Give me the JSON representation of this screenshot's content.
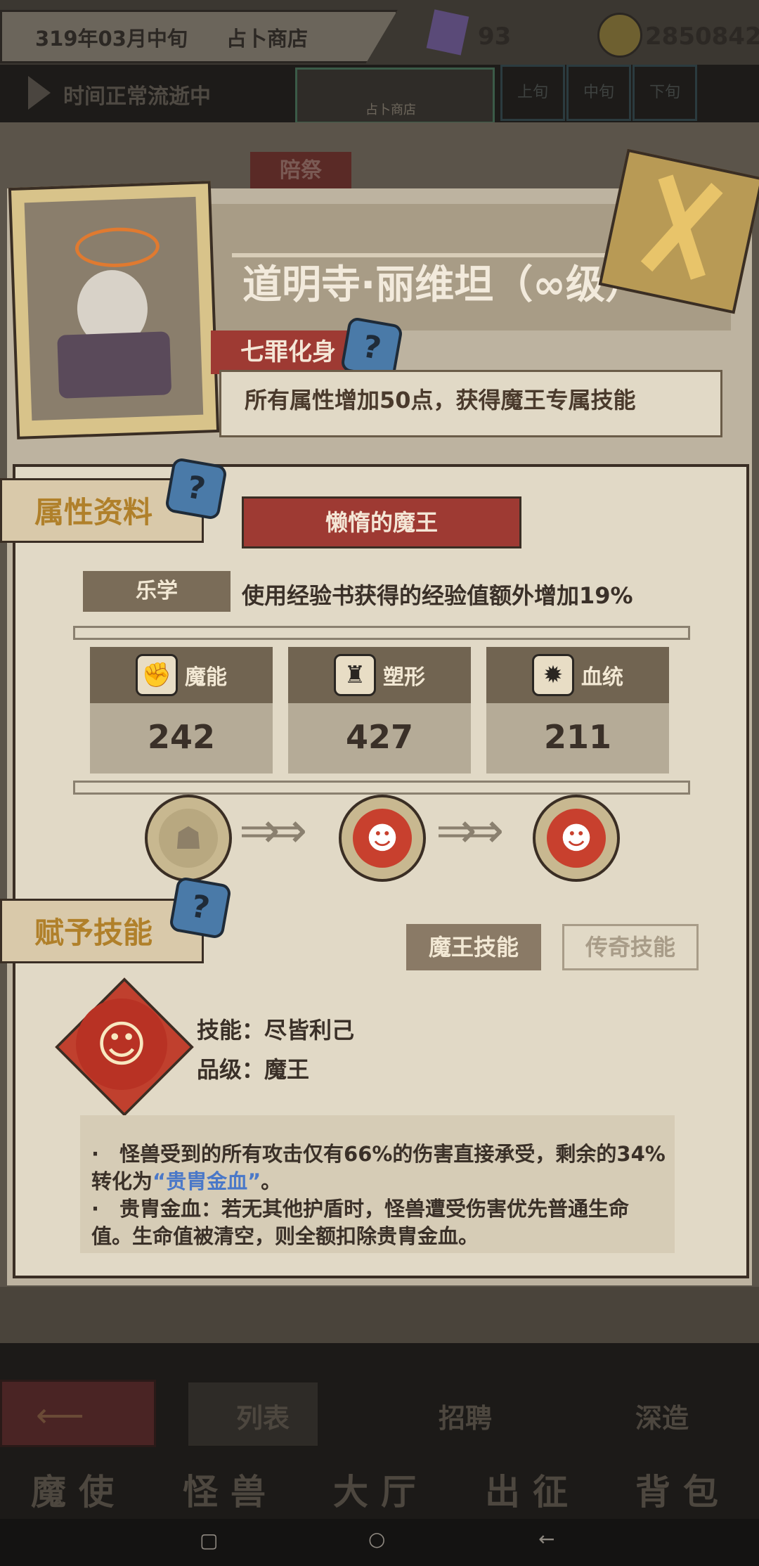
{
  "top": {
    "date": "319年03月中旬",
    "shop": "占卜商店",
    "gems": "93",
    "coins": "2850842"
  },
  "timebar": {
    "status": "时间正常流逝中",
    "thumb_label": "占卜商店",
    "slots": [
      "上旬",
      "中旬",
      "下旬"
    ]
  },
  "bg_tag": "陪祭",
  "character": {
    "name": "道明寺·丽维坦（∞级）",
    "trait_tag": "七罪化身",
    "trait_desc": "所有属性增加50点，获得魔王专属技能"
  },
  "attributes": {
    "section": "属性资料",
    "title": "懒惰的魔王",
    "specialty": {
      "label": "乐学",
      "desc": "使用经验书获得的经验值额外增加19%"
    },
    "stats": [
      {
        "label": "魔能",
        "value": "242",
        "icon": "claw-icon"
      },
      {
        "label": "塑形",
        "value": "427",
        "icon": "armor-icon"
      },
      {
        "label": "血统",
        "value": "211",
        "icon": "blood-cell-icon"
      }
    ]
  },
  "skills": {
    "section": "赋予技能",
    "tab_active": "魔王技能",
    "tab_other": "传奇技能",
    "name_line": "技能：尽皆利己",
    "grade_line": "品级：魔王",
    "desc1_a": "·　怪兽受到的所有攻击仅有66%的伤害直接承受，剩余的34%转化为",
    "desc1_hl": "“贵胄金血”",
    "desc1_b": "。",
    "desc2": "·　贵胄金血：若无其他护盾时，怪兽遭受伤害优先普通生命值。生命值被清空，则全额扣除贵胄金血。"
  },
  "bottom": {
    "tabs": [
      "列表",
      "招聘",
      "深造"
    ],
    "nav": [
      "魔使",
      "怪兽",
      "大厅",
      "出征",
      "背包"
    ]
  },
  "colors": {
    "accent_red": "#9e3a33",
    "highlight_blue": "#4a78c8",
    "parchment": "#e1d9c6"
  }
}
